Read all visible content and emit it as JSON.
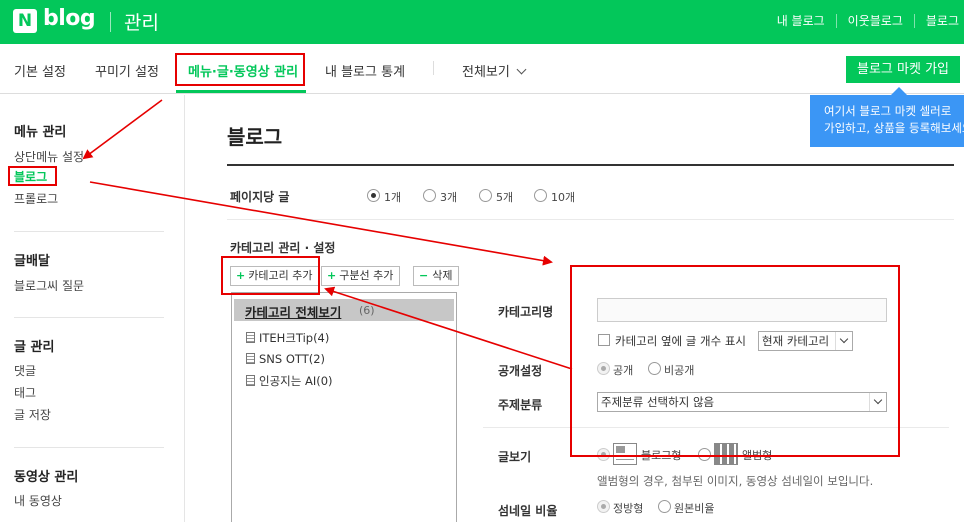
{
  "header": {
    "logo_n": "N",
    "logo_blog": "blog",
    "section": "관리",
    "links": [
      "내 블로그",
      "이웃블로그",
      "블로그"
    ]
  },
  "tabs": [
    {
      "label": "기본 설정"
    },
    {
      "label": "꾸미기 설정"
    },
    {
      "label": "메뉴·글·동영상 관리"
    },
    {
      "label": "내 블로그 통계"
    },
    {
      "label": "전체보기"
    }
  ],
  "market_button": "블로그 마켓 가입",
  "tooltip": {
    "line1": "여기서 블로그 마켓 셀러로",
    "line2": "가입하고, 상품을 등록해보세요"
  },
  "sidebar": {
    "groups": [
      {
        "title": "메뉴 관리",
        "items": [
          "상단메뉴 설정",
          "블로그",
          "프롤로그"
        ]
      },
      {
        "title": "글배달",
        "items": [
          "블로그씨 질문"
        ]
      },
      {
        "title": "글 관리",
        "items": [
          "댓글",
          "태그",
          "글 저장"
        ]
      },
      {
        "title": "동영상 관리",
        "items": [
          "내 동영상"
        ]
      }
    ]
  },
  "main": {
    "title": "블로그",
    "posts_per_page": {
      "label": "페이지당 글",
      "options": [
        "1개",
        "3개",
        "5개",
        "10개"
      ],
      "selected": "1개"
    },
    "category": {
      "section_title": "카테고리 관리 · 설정",
      "buttons": {
        "add_category": "카테고리 추가",
        "add_divider": "구분선 추가",
        "delete": "삭제"
      },
      "tree": {
        "root_label": "카테고리 전체보기",
        "root_count": "(6)",
        "items": [
          "ITEH크Tip(4)",
          "SNS OTT(2)",
          "인공지는 AI(0)"
        ]
      }
    },
    "form": {
      "category_name_label": "카테고리명",
      "category_name_value": "",
      "show_count_label": "카테고리 옆에 글 개수 표시",
      "show_count_checked": false,
      "count_select_value": "현재 카테고리",
      "visibility_label": "공개설정",
      "visibility_options": [
        "공개",
        "비공개"
      ],
      "visibility_selected": "공개",
      "topic_label": "주제분류",
      "topic_select_value": "주제분류 선택하지 않음",
      "view_label": "글보기",
      "view_options": [
        "블로그형",
        "앨범형"
      ],
      "view_selected": "블로그형",
      "view_hint": "앨범형의 경우, 첨부된 이미지, 동영상 섬네일이 보입니다.",
      "thumb_label": "섬네일 비율",
      "thumb_options": [
        "정방형",
        "원본비율"
      ],
      "thumb_selected": "정방형"
    }
  },
  "colors": {
    "brand_green": "#03c75a",
    "tooltip_blue": "#3b96f5",
    "annotation_red": "#e60000"
  }
}
